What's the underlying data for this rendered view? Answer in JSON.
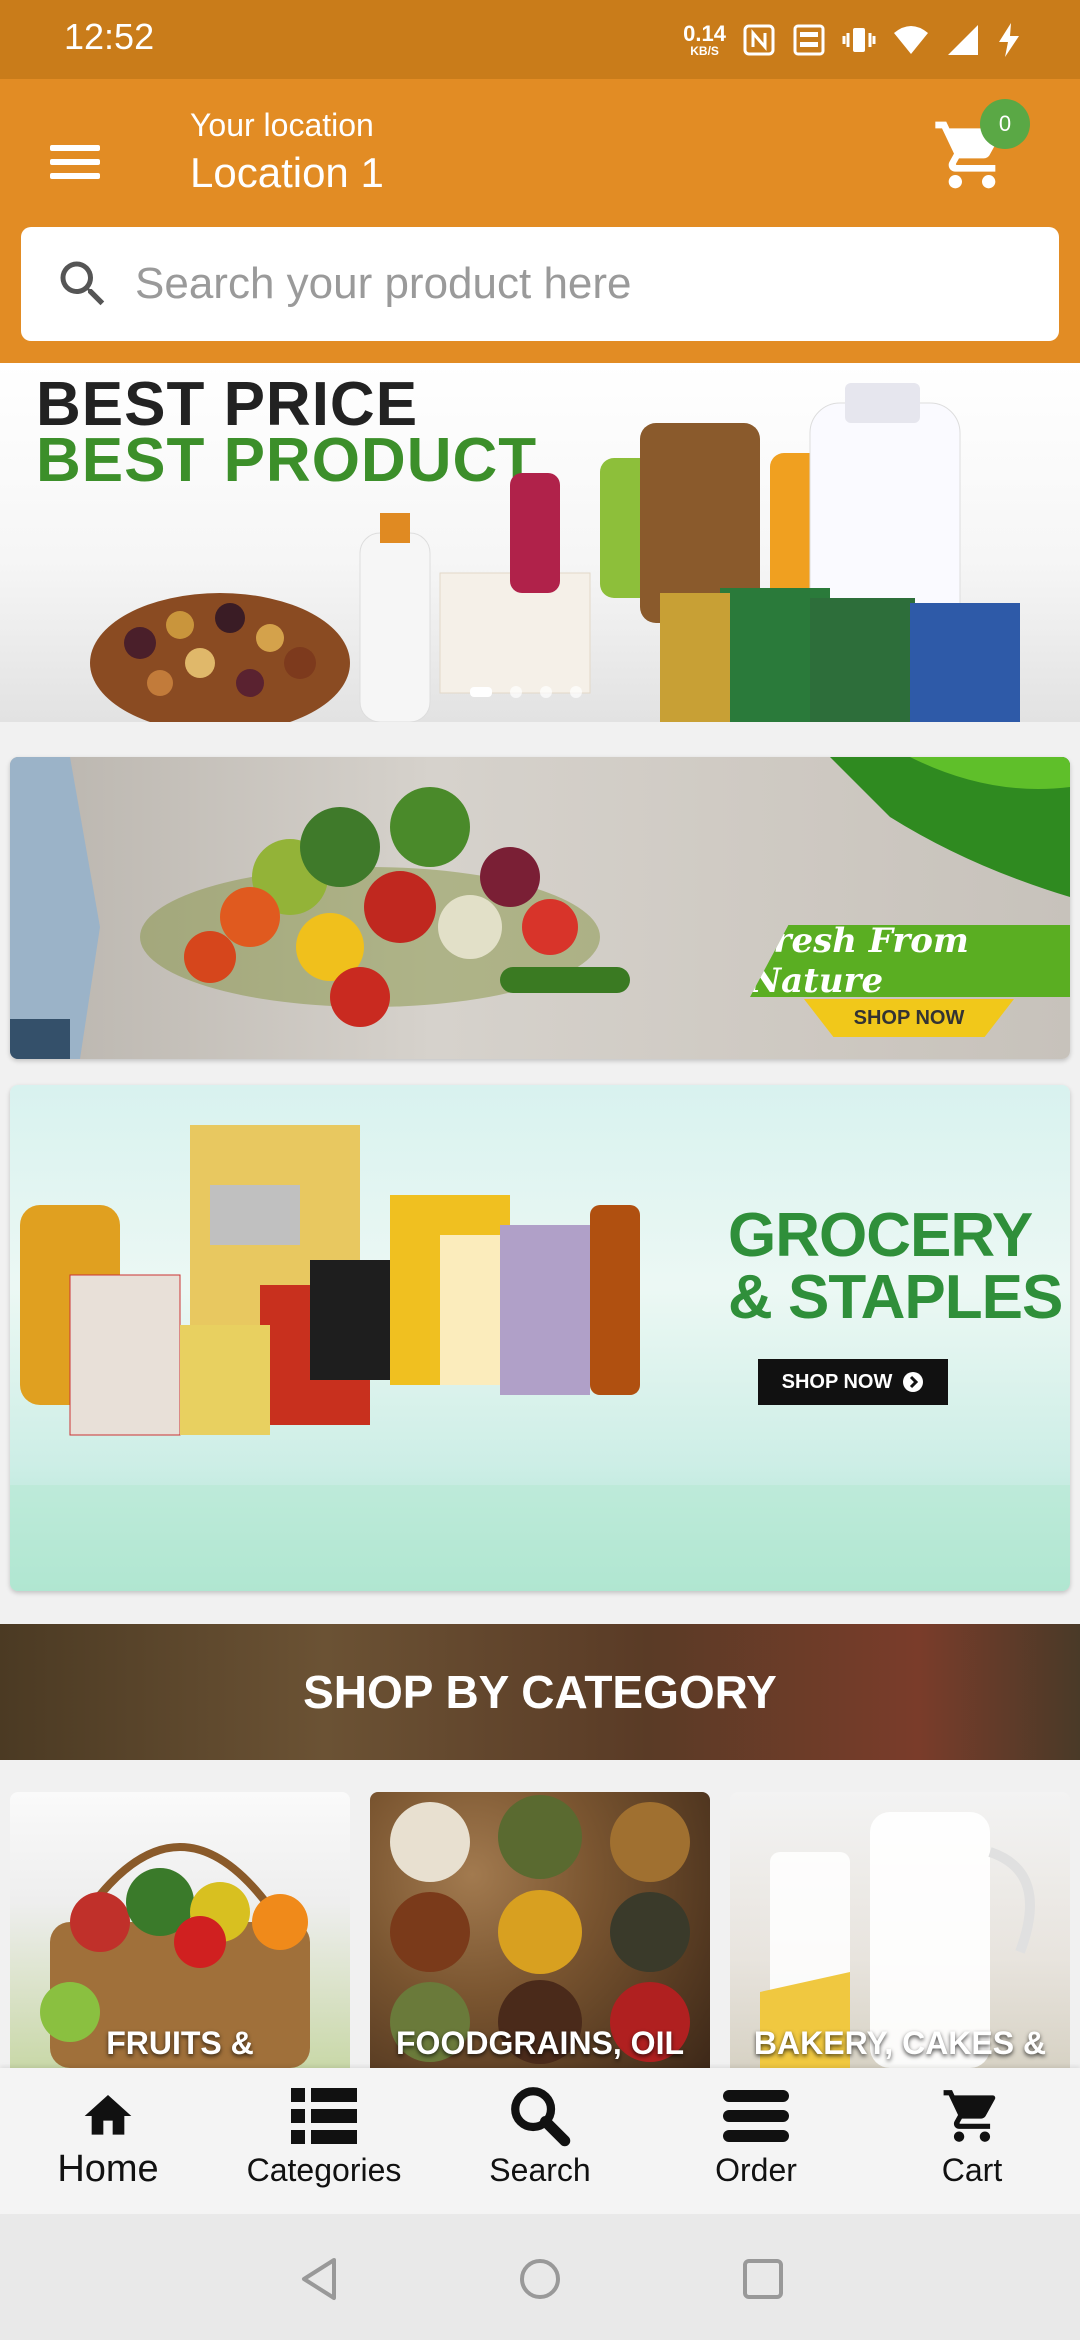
{
  "status_bar": {
    "time": "12:52",
    "net_speed_value": "0.14",
    "net_speed_unit": "KB/S",
    "icons": [
      "nfc-icon",
      "volte-icon",
      "vibrate-icon",
      "wifi-icon",
      "signal-icon",
      "charging-icon"
    ]
  },
  "header": {
    "location_label": "Your location",
    "location_value": "Location 1",
    "cart_count": "0",
    "colors": {
      "bar": "#e28c24",
      "status": "#c97c1a",
      "badge": "#5aa845"
    }
  },
  "search": {
    "placeholder": "Search your product here"
  },
  "hero": {
    "line1": "BEST PRICE",
    "line2": "BEST PRODUCT",
    "slide_count": 4,
    "active_slide": 1
  },
  "banners": {
    "fresh": {
      "title": "Fresh From Nature",
      "cta": "SHOP NOW"
    },
    "grocery": {
      "title_line1": "GROCERY",
      "title_line2": "& STAPLES",
      "cta": "SHOP NOW"
    }
  },
  "categories": {
    "heading": "SHOP BY CATEGORY",
    "items": [
      {
        "label": "FRUITS &"
      },
      {
        "label": "FOODGRAINS, OIL"
      },
      {
        "label": "BAKERY, CAKES &"
      }
    ]
  },
  "bottom_nav": {
    "active": "Home",
    "items": [
      {
        "label": "Home",
        "icon": "home-icon"
      },
      {
        "label": "Categories",
        "icon": "list-icon"
      },
      {
        "label": "Search",
        "icon": "search-icon"
      },
      {
        "label": "Order",
        "icon": "menu-icon"
      },
      {
        "label": "Cart",
        "icon": "cart-icon"
      }
    ]
  }
}
